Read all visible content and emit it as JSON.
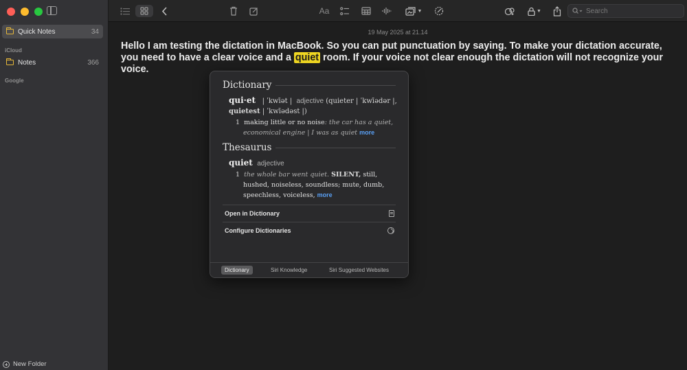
{
  "sidebar": {
    "quick_notes": {
      "label": "Quick Notes",
      "count": "34"
    },
    "icloud_section": "iCloud",
    "notes": {
      "label": "Notes",
      "count": "366"
    },
    "google_section": "Google",
    "new_folder": "New Folder"
  },
  "toolbar": {
    "format_label": "Aa",
    "search_placeholder": "Search"
  },
  "note": {
    "date": "19 May 2025 at 21.14",
    "text_before": "Hello I am testing the dictation in MacBook. So you can put punctuation by saying. To make your dictation accurate, you need to have a clear voice and a ",
    "highlight": "quiet",
    "text_after": " room. If your voice not clear enough the dictation will not recognize your voice."
  },
  "lookup": {
    "dictionary": {
      "heading": "Dictionary",
      "headword": "qui·et",
      "pron": "| ˈkwīət |",
      "pos": "adjective",
      "forms_a": "(quieter |",
      "forms_b": "ˈkwīədər |,",
      "forms_c": "quietest",
      "forms_d": "| ˈkwīədəst |)",
      "sense_num": "1",
      "sense_def": "making little or no noise",
      "sense_ex": ": the car has a quiet, economical engine | I was as quiet",
      "more": "more"
    },
    "thesaurus": {
      "heading": "Thesaurus",
      "headword": "quiet",
      "pos": "adjective",
      "sense_num": "1",
      "sense_ex": "the whole bar went quiet.",
      "syn_key": "SILENT,",
      "synonyms": "still, hushed, noiseless, soundless; mute, dumb, speechless, voiceless,",
      "more": "more"
    },
    "actions": {
      "open_dictionary": "Open in Dictionary",
      "configure": "Configure Dictionaries"
    },
    "tabs": [
      "Dictionary",
      "Siri Knowledge",
      "Siri Suggested Websites"
    ]
  },
  "colors": {
    "highlight": "#f0d722",
    "link": "#5aa0f5",
    "folder": "#e8b93a"
  }
}
